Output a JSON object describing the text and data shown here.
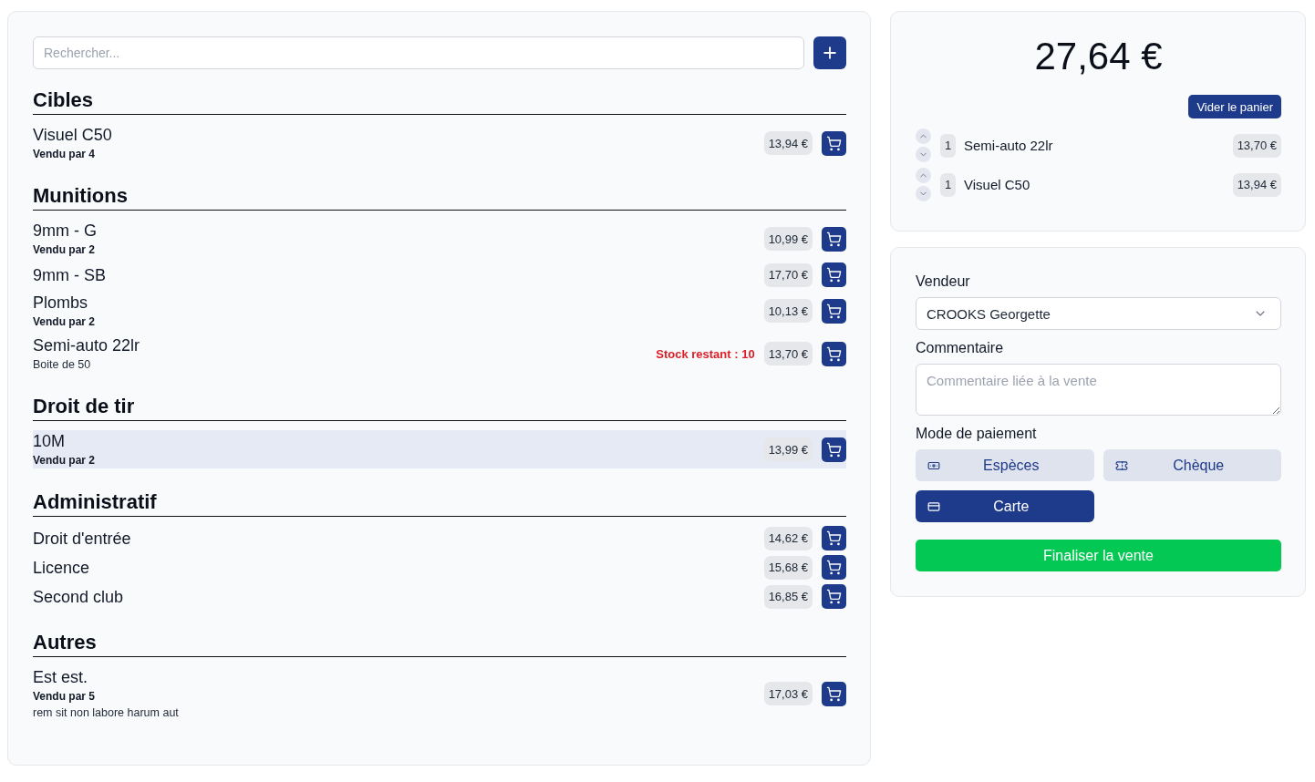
{
  "search": {
    "placeholder": "Rechercher..."
  },
  "categories": [
    {
      "title": "Cibles",
      "products": [
        {
          "name": "Visuel C50",
          "sold_by": "Vendu par 4",
          "price": "13,94 €",
          "highlighted": false
        }
      ]
    },
    {
      "title": "Munitions",
      "products": [
        {
          "name": "9mm - G",
          "sold_by": "Vendu par 2",
          "price": "10,99 €",
          "highlighted": false
        },
        {
          "name": "9mm - SB",
          "price": "17,70 €",
          "highlighted": false
        },
        {
          "name": "Plombs",
          "sold_by": "Vendu par 2",
          "price": "10,13 €",
          "highlighted": false
        },
        {
          "name": "Semi-auto 22lr",
          "description": "Boite de 50",
          "stock": "Stock restant : 10",
          "price": "13,70 €",
          "highlighted": false
        }
      ]
    },
    {
      "title": "Droit de tir",
      "products": [
        {
          "name": "10M",
          "sold_by": "Vendu par 2",
          "price": "13,99 €",
          "highlighted": true
        }
      ]
    },
    {
      "title": "Administratif",
      "products": [
        {
          "name": "Droit d'entrée",
          "price": "14,62 €",
          "highlighted": false
        },
        {
          "name": "Licence",
          "price": "15,68 €",
          "highlighted": false
        },
        {
          "name": "Second club",
          "price": "16,85 €",
          "highlighted": false
        }
      ]
    },
    {
      "title": "Autres",
      "products": [
        {
          "name": "Est est.",
          "sold_by": "Vendu par 5",
          "description": "rem sit non labore harum aut",
          "price": "17,03 €",
          "highlighted": false
        }
      ]
    }
  ],
  "cart": {
    "total": "27,64 €",
    "clear_button": "Vider le panier",
    "lines": [
      {
        "quantity": "1",
        "name": "Semi-auto 22lr",
        "price": "13,70 €"
      },
      {
        "quantity": "1",
        "name": "Visuel C50",
        "price": "13,94 €"
      }
    ]
  },
  "checkout": {
    "seller": {
      "label": "Vendeur",
      "value": "CROOKS Georgette"
    },
    "comment": {
      "label": "Commentaire",
      "placeholder": "Commentaire liée à la vente"
    },
    "payment": {
      "label": "Mode de paiement",
      "methods": [
        {
          "kind": "cash",
          "label": "Espèces",
          "selected": false
        },
        {
          "kind": "check",
          "label": "Chèque",
          "selected": false
        },
        {
          "kind": "card",
          "label": "Carte",
          "selected": true
        }
      ]
    },
    "submit_button": "Finaliser la vente"
  }
}
